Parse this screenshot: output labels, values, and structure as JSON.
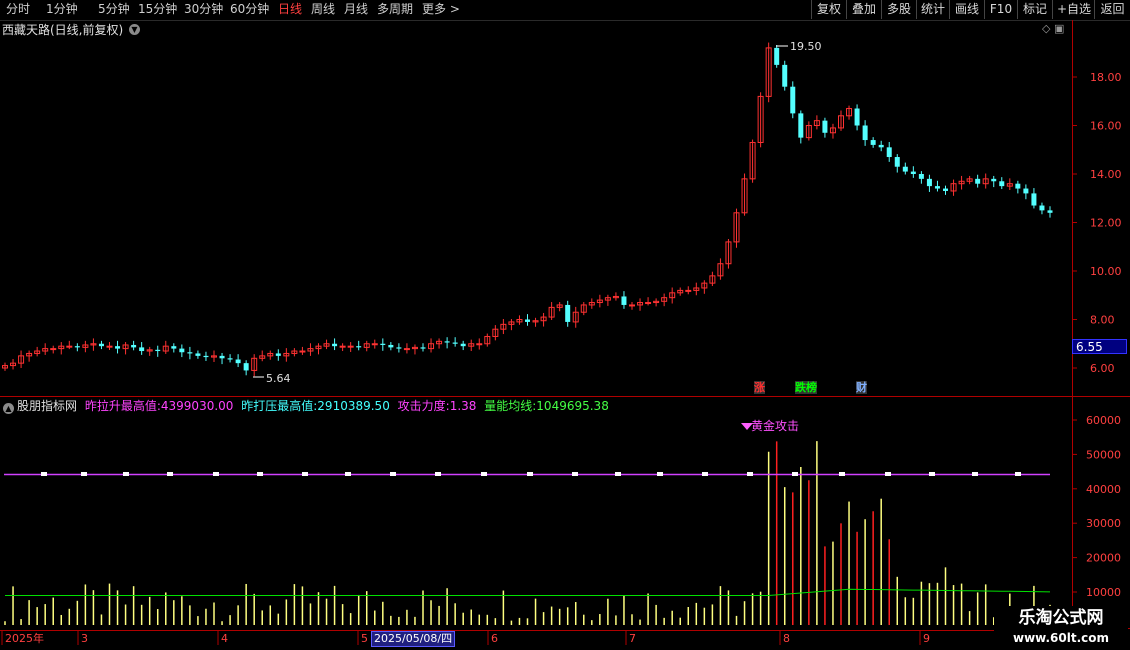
{
  "toolbar": {
    "periods": [
      "分时",
      "1分钟",
      "5分钟",
      "15分钟",
      "30分钟",
      "60分钟",
      "日线",
      "周线",
      "月线",
      "多周期",
      "更多 >"
    ],
    "active_period": "日线",
    "tools": [
      "复权",
      "叠加",
      "多股",
      "统计",
      "画线",
      "F10",
      "标记",
      "+自选",
      "返回"
    ]
  },
  "stock": {
    "title": "西藏天路(日线,前复权)",
    "high_label": "19.50",
    "low_label": "5.64",
    "current_price_tag": "6.55",
    "event_flags": [
      "涨",
      "跌榜",
      "财"
    ]
  },
  "price_axis": {
    "ticks": [
      "18.00",
      "16.00",
      "14.00",
      "12.00",
      "10.00",
      "8.00",
      "6.00"
    ]
  },
  "indicator": {
    "name": "股朋指标网",
    "fields": [
      {
        "label": "昨拉升最高值:",
        "value": "4399030.00",
        "color": "#ff44ff"
      },
      {
        "label": "昨打压最高值:",
        "value": "2910389.50",
        "color": "#44ffff"
      },
      {
        "label": "攻击力度:",
        "value": "1.38",
        "color": "#ff44ff"
      },
      {
        "label": "量能均线:",
        "value": "1049695.38",
        "color": "#44ff44"
      }
    ],
    "signal_text": "黄金攻击",
    "axis_ticks": [
      "60000",
      "50000",
      "40000",
      "30000",
      "20000",
      "10000"
    ]
  },
  "time_axis": {
    "labels": [
      "2025年",
      "3",
      "4",
      "5",
      "6",
      "7",
      "8",
      "9"
    ],
    "highlight_date": "2025/05/08/四"
  },
  "watermark": {
    "line1": "乐淘公式网",
    "line2": "www.60lt.com"
  },
  "colors": {
    "up": "#ff3232",
    "down": "#54ffff",
    "axis": "#b00000",
    "vol_yellow": "#ffff80",
    "ma": "#00e000",
    "purple": "#d040ff"
  }
}
